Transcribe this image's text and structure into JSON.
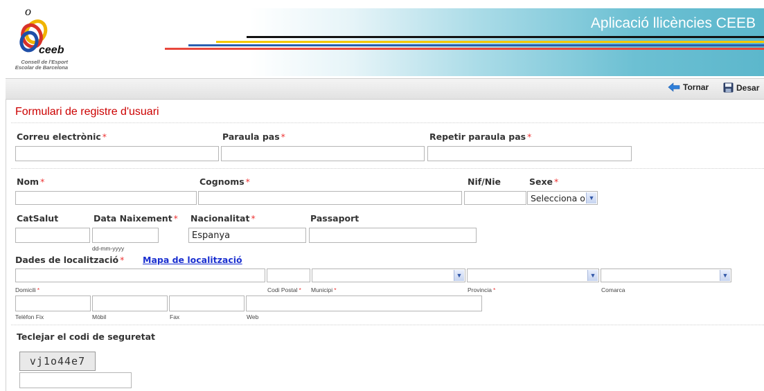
{
  "app": {
    "title": "Aplicació llicències CEEB"
  },
  "logo": {
    "text_line1": "Consell de l'Esport",
    "text_line2": "Escolar de Barcelona",
    "wordmark": "ceeb"
  },
  "toolbar": {
    "back_label": "Tornar",
    "save_label": "Desar"
  },
  "form": {
    "title": "Formulari de registre d'usuari",
    "required_mark": "*",
    "email_label": "Correu electrònic",
    "password_label": "Paraula pas",
    "repeat_password_label": "Repetir paraula pas",
    "name_label": "Nom",
    "surname_label": "Cognoms",
    "nif_label": "Nif/Nie",
    "sex_label": "Sexe",
    "sex_value": "Selecciona opció",
    "catsalut_label": "CatSalut",
    "birthdate_label": "Data Naixement",
    "birthdate_hint": "dd-mm-yyyy",
    "nationality_label": "Nacionalitat",
    "nationality_value": "Espanya",
    "passport_label": "Passaport",
    "location_label": "Dades de localització",
    "map_link": "Mapa de localització",
    "address_label": "Domicili",
    "postal_code_label": "Codi Postal",
    "municipality_label": "Municipi",
    "province_label": "Provincia",
    "county_label": "Comarca",
    "phone_label": "Telèfon Fix",
    "mobile_label": "Mòbil",
    "fax_label": "Fax",
    "web_label": "Web",
    "captcha_label": "Teclejar el codi de seguretat",
    "captcha_code": "vj1o44e7"
  },
  "colors": {
    "title_red": "#cc0000",
    "link_blue": "#1a2fd0",
    "header_teal": "#5cb7cc"
  }
}
